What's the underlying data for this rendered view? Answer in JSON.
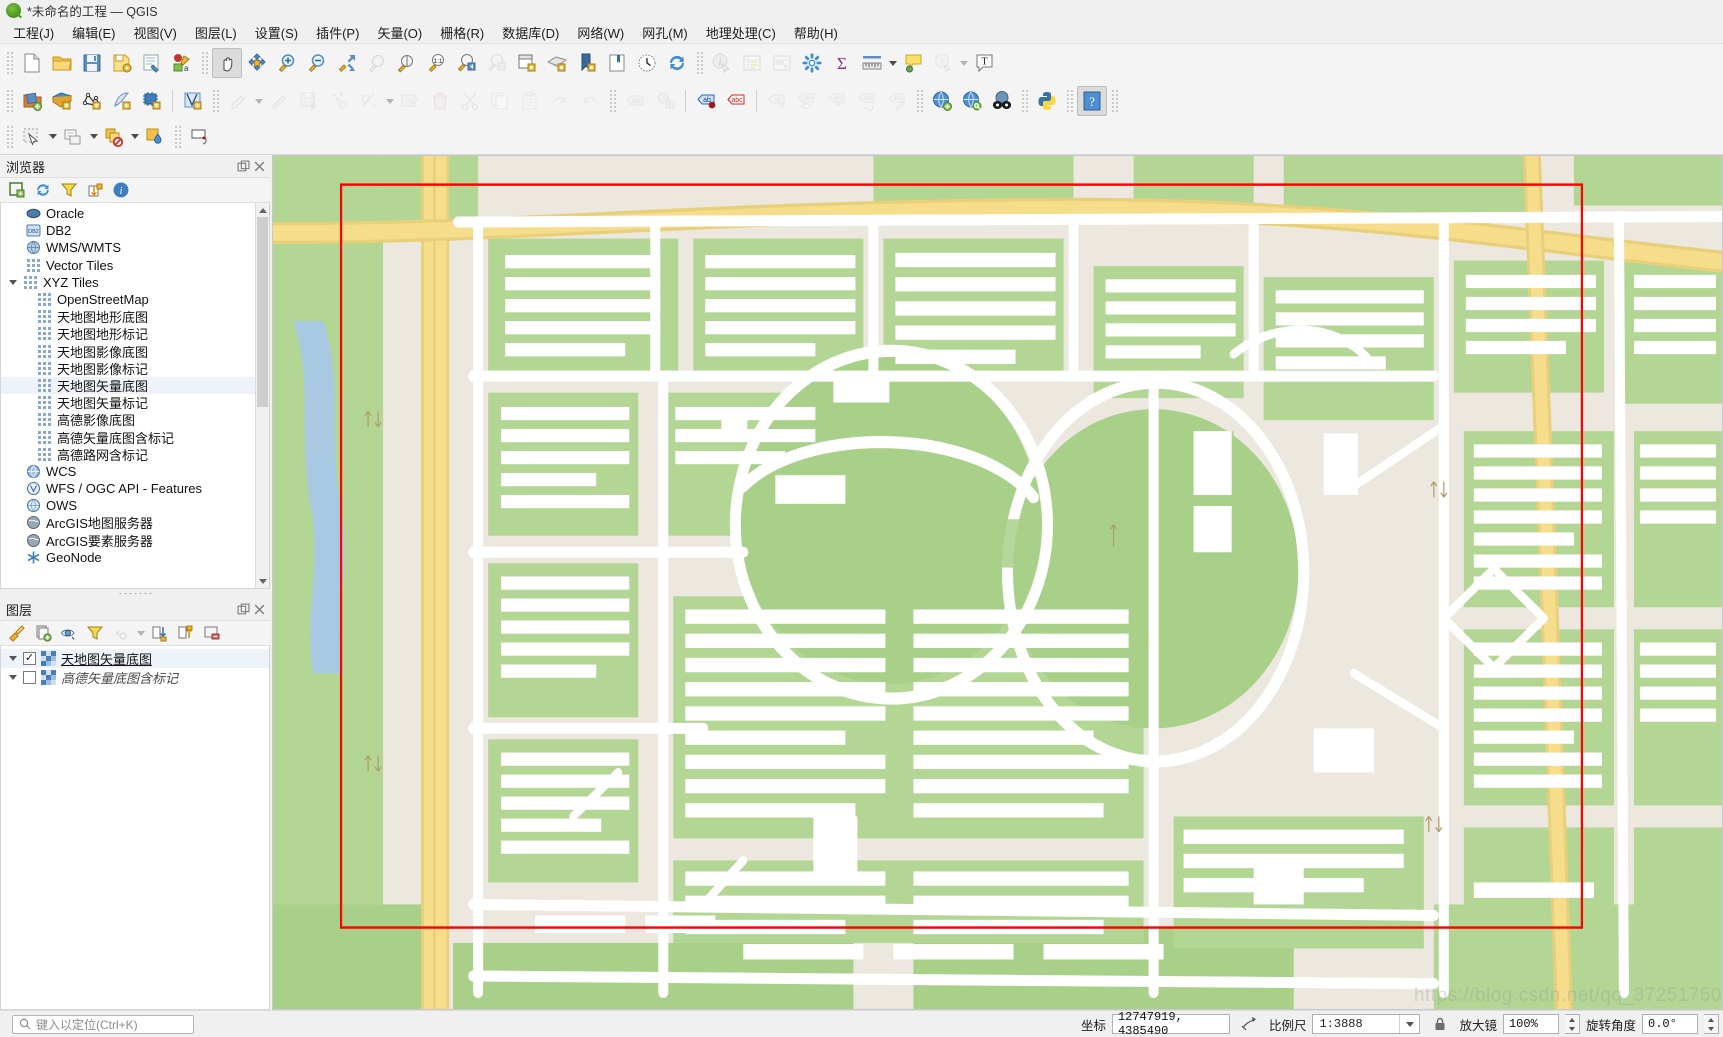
{
  "window": {
    "title": "*未命名的工程 — QGIS",
    "logo_icon": "qgis-logo-icon"
  },
  "menubar": {
    "items": [
      {
        "label": "工程(J)"
      },
      {
        "label": "编辑(E)"
      },
      {
        "label": "视图(V)"
      },
      {
        "label": "图层(L)"
      },
      {
        "label": "设置(S)"
      },
      {
        "label": "插件(P)"
      },
      {
        "label": "矢量(O)"
      },
      {
        "label": "栅格(R)"
      },
      {
        "label": "数据库(D)"
      },
      {
        "label": "网络(W)"
      },
      {
        "label": "网孔(M)"
      },
      {
        "label": "地理处理(C)"
      },
      {
        "label": "帮助(H)"
      }
    ]
  },
  "toolbars": {
    "row1": [
      {
        "icon": "new-project-icon"
      },
      {
        "icon": "open-project-icon"
      },
      {
        "icon": "save-project-icon"
      },
      {
        "icon": "save-project-as-icon"
      },
      {
        "icon": "new-print-layout-icon"
      },
      {
        "icon": "style-manager-icon"
      },
      {
        "icon": "pan-map-icon",
        "active": true
      },
      {
        "icon": "pan-to-selection-icon"
      },
      {
        "icon": "zoom-in-icon"
      },
      {
        "icon": "zoom-out-icon"
      },
      {
        "icon": "zoom-full-icon"
      },
      {
        "icon": "zoom-to-selection-icon",
        "dim": true
      },
      {
        "icon": "zoom-to-layer-icon"
      },
      {
        "icon": "zoom-native-icon"
      },
      {
        "icon": "zoom-last-icon"
      },
      {
        "icon": "zoom-next-icon",
        "dim": true
      },
      {
        "icon": "new-map-view-icon"
      },
      {
        "icon": "new-3d-map-view-icon"
      },
      {
        "icon": "new-bookmark-icon"
      },
      {
        "icon": "show-bookmarks-icon"
      },
      {
        "icon": "temporal-controller-icon"
      },
      {
        "icon": "refresh-icon"
      },
      {
        "icon": "identify-features-icon",
        "dim": true
      },
      {
        "icon": "attribute-table-icon",
        "dim": true
      },
      {
        "icon": "field-calculator-icon",
        "dim": true
      },
      {
        "icon": "processing-toolbox-icon"
      },
      {
        "icon": "statistical-summary-icon"
      },
      {
        "icon": "measure-line-icon"
      },
      {
        "icon": "map-tips-icon"
      },
      {
        "icon": "show-spatial-bookmarks-icon",
        "dim": true
      },
      {
        "icon": "text-annotation-icon"
      }
    ],
    "row2": [
      {
        "icon": "open-data-source-manager-icon"
      },
      {
        "icon": "add-vector-layer-icon"
      },
      {
        "icon": "add-raster-layer-icon"
      },
      {
        "icon": "add-mesh-layer-icon"
      },
      {
        "icon": "add-delimited-text-layer-icon"
      },
      {
        "icon": "add-virtual-layer-icon"
      },
      {
        "icon": "current-edits-icon",
        "dim": true
      },
      {
        "icon": "toggle-editing-icon",
        "dim": true
      },
      {
        "icon": "save-layer-edits-icon",
        "dim": true
      },
      {
        "icon": "vertex-tool-icon",
        "dim": true
      },
      {
        "icon": "modify-attributes-icon",
        "dim": true
      },
      {
        "icon": "multi-edit-icon",
        "dim": true
      },
      {
        "icon": "delete-selected-icon",
        "dim": true
      },
      {
        "icon": "cut-features-icon",
        "dim": true
      },
      {
        "icon": "copy-features-icon",
        "dim": true
      },
      {
        "icon": "paste-features-icon",
        "dim": true
      },
      {
        "icon": "undo-icon",
        "dim": true
      },
      {
        "icon": "redo-icon",
        "dim": true
      },
      {
        "icon": "label-abc-icon",
        "dim": true
      },
      {
        "icon": "diagram-icon",
        "dim": true
      },
      {
        "icon": "pin-labels-icon"
      },
      {
        "icon": "highlight-labels-icon"
      },
      {
        "icon": "move-label-icon",
        "dim": true
      },
      {
        "icon": "show-hide-labels-icon",
        "dim": true
      },
      {
        "icon": "change-label-icon",
        "dim": true
      },
      {
        "icon": "rotate-label-icon",
        "dim": true
      },
      {
        "icon": "edit-label-icon",
        "dim": true
      },
      {
        "icon": "add-wms-layer-icon"
      },
      {
        "icon": "metasearch-icon"
      },
      {
        "icon": "osm-place-search-icon"
      },
      {
        "icon": "python-console-icon"
      },
      {
        "icon": "help-icon",
        "active": true
      }
    ],
    "row3": [
      {
        "icon": "select-features-icon"
      },
      {
        "icon": "select-value-icon"
      },
      {
        "icon": "deselect-features-icon"
      },
      {
        "icon": "select-by-location-icon"
      },
      {
        "icon": "measure-area-icon"
      }
    ]
  },
  "browser_panel": {
    "title": "浏览器",
    "float_icon": "undock-icon",
    "close_icon": "close-icon",
    "toolbar": [
      {
        "icon": "add-layer-selected-icon"
      },
      {
        "icon": "refresh-icon"
      },
      {
        "icon": "filter-browser-icon"
      },
      {
        "icon": "collapse-all-icon"
      },
      {
        "icon": "show-properties-icon"
      }
    ],
    "items": [
      {
        "label": "Oracle",
        "icon": "oracle-icon",
        "indent": 1
      },
      {
        "label": "DB2",
        "icon": "db2-icon",
        "indent": 1
      },
      {
        "label": "WMS/WMTS",
        "icon": "wms-icon",
        "indent": 1
      },
      {
        "label": "Vector Tiles",
        "icon": "grid-icon",
        "indent": 1
      },
      {
        "label": "XYZ Tiles",
        "icon": "grid-icon",
        "indent": 1,
        "expanded": true
      },
      {
        "label": "OpenStreetMap",
        "icon": "grid-icon",
        "indent": 2
      },
      {
        "label": "天地图地形底图",
        "icon": "grid-icon",
        "indent": 2
      },
      {
        "label": "天地图地形标记",
        "icon": "grid-icon",
        "indent": 2
      },
      {
        "label": "天地图影像底图",
        "icon": "grid-icon",
        "indent": 2
      },
      {
        "label": "天地图影像标记",
        "icon": "grid-icon",
        "indent": 2
      },
      {
        "label": "天地图矢量底图",
        "icon": "grid-icon",
        "indent": 2,
        "selected": true
      },
      {
        "label": "天地图矢量标记",
        "icon": "grid-icon",
        "indent": 2
      },
      {
        "label": "高德影像底图",
        "icon": "grid-icon",
        "indent": 2
      },
      {
        "label": "高德矢量底图含标记",
        "icon": "grid-icon",
        "indent": 2
      },
      {
        "label": "高德路网含标记",
        "icon": "grid-icon",
        "indent": 2
      },
      {
        "label": "WCS",
        "icon": "globe-icon",
        "indent": 1
      },
      {
        "label": "WFS / OGC API - Features",
        "icon": "wfs-icon",
        "indent": 1
      },
      {
        "label": "OWS",
        "icon": "globe-icon",
        "indent": 1
      },
      {
        "label": "ArcGIS地图服务器",
        "icon": "arcgis-icon",
        "indent": 1
      },
      {
        "label": "ArcGIS要素服务器",
        "icon": "arcgis-icon",
        "indent": 1
      },
      {
        "label": "GeoNode",
        "icon": "geonode-icon",
        "indent": 1
      }
    ]
  },
  "layers_panel": {
    "title": "图层",
    "float_icon": "undock-icon",
    "close_icon": "close-icon",
    "toolbar": [
      {
        "icon": "open-layer-styling-icon"
      },
      {
        "icon": "add-group-icon"
      },
      {
        "icon": "manage-map-themes-icon"
      },
      {
        "icon": "filter-legend-icon"
      },
      {
        "icon": "filter-legend-expression-icon",
        "dim": true
      },
      {
        "icon": "expand-all-icon"
      },
      {
        "icon": "collapse-all-icon"
      },
      {
        "icon": "remove-layer-icon"
      }
    ],
    "layers": [
      {
        "label": "天地图矢量底图",
        "checked": true,
        "selected": true,
        "icon": "tiles-layer-icon"
      },
      {
        "label": "高德矢量底图含标记",
        "checked": false,
        "selected": false,
        "icon": "tiles-layer-icon"
      }
    ]
  },
  "statusbar": {
    "locator_placeholder": "键入以定位(Ctrl+K)",
    "locator_icon": "search-icon",
    "coordinate_label": "坐标",
    "coordinate_value": "12747919, 4385490",
    "toggle_extents_icon": "toggle-extents-icon",
    "scale_label": "比例尺",
    "scale_value": "1:3888",
    "scale_dropdown_icon": "chevron-down-icon",
    "lock_icon": "lock-scale-icon",
    "magnifier_label": "放大镜",
    "magnifier_value": "100%",
    "rotation_label": "旋转角度",
    "rotation_value": "0.0°"
  },
  "map": {
    "watermark": "https://blog.csdn.net/qq_37251750",
    "selection_rect_color": "#ff0000",
    "colors": {
      "landuse_green": "#b8d8a0",
      "park_green": "#a8d190",
      "background": "#e8e4dc",
      "road_casing": "#ffffff",
      "major_road": "#f7de8a",
      "building": "#ffffff",
      "water": "#a7c8e0"
    }
  }
}
